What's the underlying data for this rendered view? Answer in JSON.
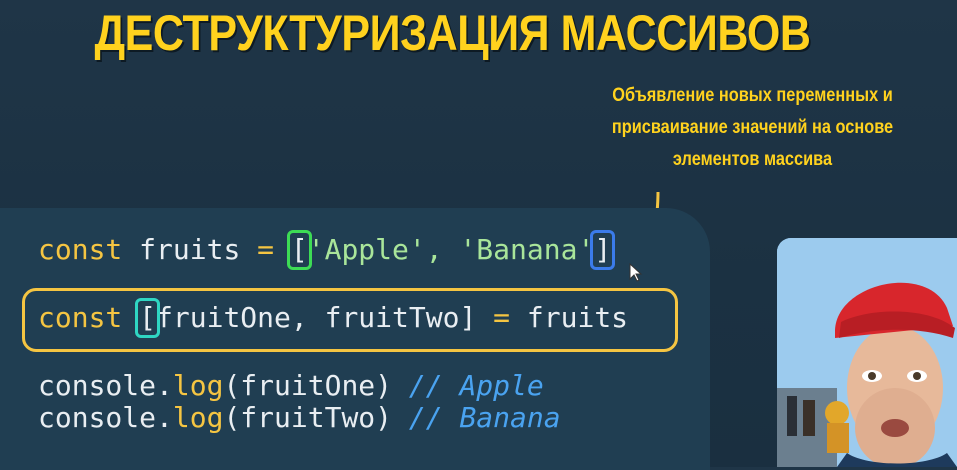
{
  "title": "ДЕСТРУКТУРИЗАЦИЯ МАССИВОВ",
  "note": {
    "line1": "Объявление новых переменных и",
    "line2": "присваивание значений на основе",
    "line3": "элементов массива"
  },
  "code": {
    "line1": {
      "kw": "const",
      "name": " fruits ",
      "op": "=",
      "open": "[",
      "items": "'Apple', 'Banana'",
      "close": "]"
    },
    "line2": {
      "kw": "const",
      "open": "[",
      "names": "fruitOne, fruitTwo]",
      "op": "=",
      "rhs": " fruits"
    },
    "line3": {
      "obj": "console.",
      "fn": "log",
      "args": "(fruitOne)",
      "comment": " // Apple"
    },
    "line4": {
      "obj": "console.",
      "fn": "log",
      "args": "(fruitTwo)",
      "comment": " // Banana"
    }
  },
  "colors": {
    "title": "#ffd21e",
    "keyword": "#f5c542",
    "string": "#a9e59a",
    "comment": "#4aa3f0",
    "box_green": "#3ddc55",
    "box_blue": "#3b7bea",
    "box_cyan": "#2fd6c3",
    "background": "#1d3344",
    "panel": "#203e52"
  },
  "icons": {
    "arrow": "arrow-down-icon",
    "cursor": "mouse-cursor-icon"
  }
}
